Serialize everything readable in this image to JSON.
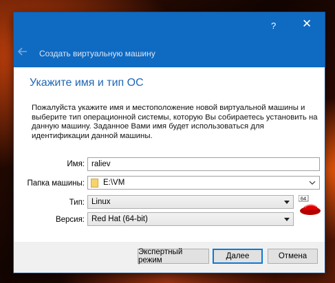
{
  "window": {
    "help_glyph": "?",
    "close_glyph": "✕",
    "wizard_title": "Создать виртуальную машину",
    "accent_color": "#0f6ac2"
  },
  "page": {
    "heading": "Укажите имя и тип ОС",
    "description": "Пожалуйста укажите имя и местоположение новой виртуальной машины и выберите тип операционной системы, которую Вы собираетесь установить на данную машину. Заданное Вами имя будет использоваться для идентификации данной машины."
  },
  "form": {
    "name_label": "Имя:",
    "name_value": "raliev",
    "folder_label": "Папка машины:",
    "folder_value": "E:\\VM",
    "type_label": "Тип:",
    "type_value": "Linux",
    "version_label": "Версия:",
    "version_value": "Red Hat (64-bit)",
    "os_icon": "redhat-64-icon",
    "os_icon_badge": "64"
  },
  "buttons": {
    "expert": "Экспертный режим",
    "next": "Далее",
    "cancel": "Отмена"
  }
}
